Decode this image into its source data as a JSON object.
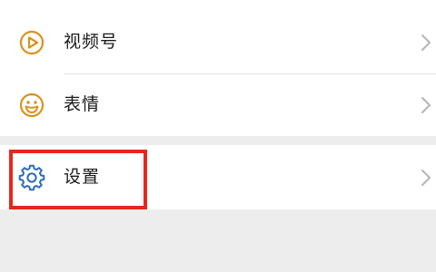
{
  "menu": {
    "items": [
      {
        "label": "视频号",
        "icon": "play-circle-icon"
      },
      {
        "label": "表情",
        "icon": "smiley-icon"
      },
      {
        "label": "设置",
        "icon": "gear-icon"
      }
    ]
  },
  "colors": {
    "icon_orange": "#d9921c",
    "icon_blue": "#2c6bbd",
    "highlight_red": "#e8271c",
    "chevron_gray": "#b5b5b5"
  }
}
